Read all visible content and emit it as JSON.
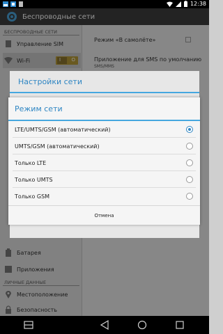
{
  "status_bar": {
    "time": "12:38"
  },
  "action_bar": {
    "title": "Беспроводные сети"
  },
  "left_pane": {
    "section_wireless": "БЕСПРОВОДНЫЕ СЕТИ",
    "items": [
      {
        "label": "Управление SIM"
      },
      {
        "label": "Wi-Fi",
        "toggle_on": "I",
        "toggle_off": "O"
      }
    ],
    "device_items": [
      {
        "label": "Батарея"
      },
      {
        "label": "Приложения"
      }
    ],
    "section_personal": "ЛИЧНЫЕ ДАННЫЕ",
    "personal_items": [
      {
        "label": "Местоположение"
      },
      {
        "label": "Безопасность"
      }
    ]
  },
  "right_pane": {
    "airplane": "Режим «В самолёте»",
    "sms_app": "Приложение для SMS по умолчанию",
    "sms_sub": "SMS/MMS"
  },
  "back_dialog": {
    "title": "Настройки сети"
  },
  "dialog": {
    "title": "Режим сети",
    "options": [
      {
        "label": "LTE/UMTS/GSM (автоматический)",
        "selected": true
      },
      {
        "label": "UMTS/GSM (автоматический)",
        "selected": false
      },
      {
        "label": "Только LTE",
        "selected": false
      },
      {
        "label": "Только UMTS",
        "selected": false
      },
      {
        "label": "Только GSM",
        "selected": false
      }
    ],
    "cancel": "Отмена"
  },
  "colors": {
    "accent": "#2f86c3",
    "action_bar": "#3d3d3d",
    "toggle": "#b59a38"
  }
}
